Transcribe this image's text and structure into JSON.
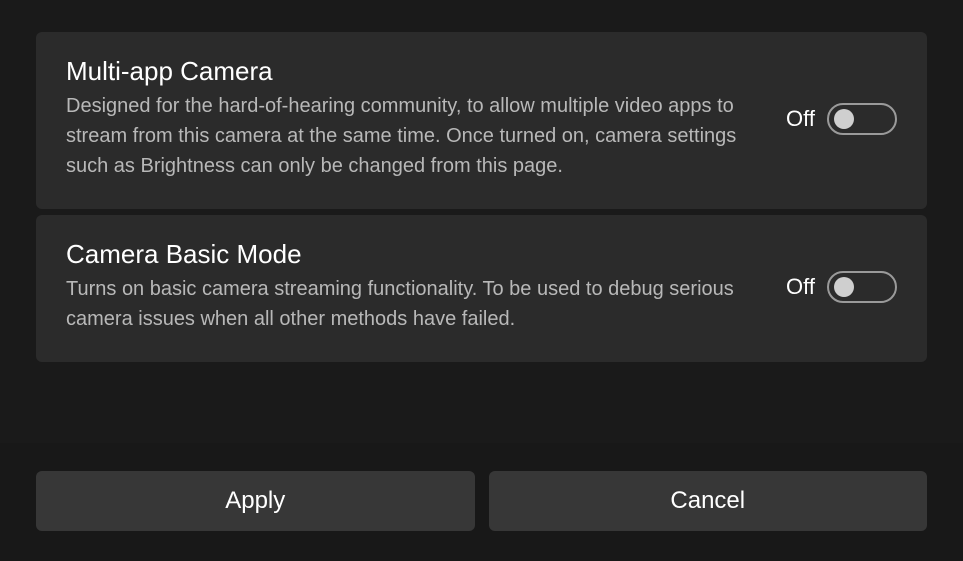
{
  "settings": [
    {
      "title": "Multi-app Camera",
      "description": "Designed for the hard-of-hearing community, to allow multiple video apps to stream from this camera at the same time. Once turned on, camera settings such as Brightness can only be changed from this page.",
      "state_label": "Off"
    },
    {
      "title": "Camera Basic Mode",
      "description": "Turns on basic camera streaming functionality. To be used to debug serious camera issues when all other methods have failed.",
      "state_label": "Off"
    }
  ],
  "footer": {
    "apply_label": "Apply",
    "cancel_label": "Cancel"
  }
}
